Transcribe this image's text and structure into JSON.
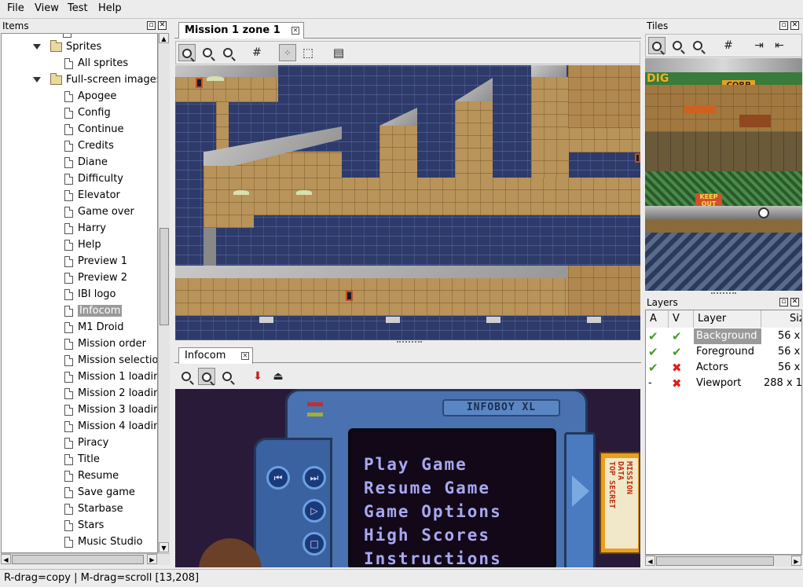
{
  "menu": {
    "file": "File",
    "view": "View",
    "test": "Test",
    "help": "Help"
  },
  "items_panel": {
    "title": "Items",
    "sprites_folder": "Sprites",
    "all_sprites": "All sprites",
    "fullscreen_folder": "Full-screen images",
    "images": [
      "Apogee",
      "Config",
      "Continue",
      "Credits",
      "Diane",
      "Difficulty",
      "Elevator",
      "Game over",
      "Harry",
      "Help",
      "Preview 1",
      "Preview 2",
      "IBI logo",
      "Infocom",
      "M1 Droid",
      "Mission order",
      "Mission selectio",
      "Mission 1 loadin",
      "Mission 2 loadin",
      "Mission 3 loadin",
      "Mission 4 loadin",
      "Piracy",
      "Title",
      "Resume",
      "Save game",
      "Starbase",
      "Stars",
      "Music Studio"
    ],
    "selected": "Infocom"
  },
  "map_tab": {
    "label": "Mission 1 zone 1"
  },
  "image_tab": {
    "label": "Infocom"
  },
  "infobox": {
    "device_label": "INFOBOY XL",
    "menu": [
      "Play Game",
      "Resume Game",
      "Game Options",
      "High Scores",
      "Instructions"
    ],
    "cartridge": [
      "MISSION",
      "DATA",
      "TOP SECRET"
    ]
  },
  "tiles_panel": {
    "title": "Tiles",
    "tile_text_1": "DIG",
    "tile_text_2": "CORP",
    "tile_text_3": "KEEP OUT"
  },
  "layers_panel": {
    "title": "Layers",
    "col_a": "A",
    "col_v": "V",
    "col_layer": "Layer",
    "col_size": "Siz",
    "rows": [
      {
        "a": "check",
        "v": "check",
        "name": "Background",
        "size": "56 x"
      },
      {
        "a": "check",
        "v": "check",
        "name": "Foreground",
        "size": "56 x"
      },
      {
        "a": "check",
        "v": "cross",
        "name": "Actors",
        "size": "56 x"
      },
      {
        "a": "-",
        "v": "cross",
        "name": "Viewport",
        "size": "288 x 1"
      }
    ],
    "selected": "Background"
  },
  "status": {
    "text": "R-drag=copy | M-drag=scroll [13,208]"
  },
  "colors": {
    "selection": "#9a9a9a",
    "check": "#4a9a2a",
    "cross": "#d82020"
  }
}
